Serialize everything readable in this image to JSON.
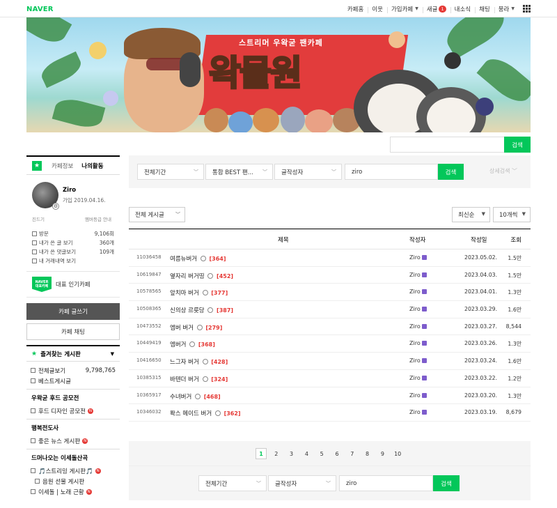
{
  "topbar": {
    "logo": "NAVER",
    "items": [
      {
        "label": "카페홈"
      },
      {
        "label": "이웃"
      },
      {
        "label": "가입카페"
      },
      {
        "label": "새글",
        "badge": "1"
      },
      {
        "label": "내소식"
      },
      {
        "label": "채팅"
      },
      {
        "label": "뭉라"
      }
    ],
    "apps_icon": "grid-icon"
  },
  "banner": {
    "subtitle": "스트리머 우왁굳 팬카페",
    "title": "왁물원"
  },
  "top_search": {
    "value": "",
    "button": "검색"
  },
  "sidebar": {
    "tabs": [
      "카페정보",
      "나의활동"
    ],
    "profile": {
      "name": "Ziro",
      "joined": "가입 2019.04.16.",
      "level_link": "진드기",
      "benefit_link": "멤버등급 안내"
    },
    "stats": [
      {
        "label": "방문",
        "value": "9,106회"
      },
      {
        "label": "내가 쓴 글 보기",
        "value": "360개"
      },
      {
        "label": "내가 쓴 댓글보기",
        "value": "109개"
      },
      {
        "label": "내 거래내역 보기",
        "value": ""
      }
    ],
    "popular_badge_top": "NAVER",
    "popular_badge_bottom": "대표카페",
    "popular_label": "대표 인기카페",
    "write_button": "카페 글쓰기",
    "chat_button": "카페 채팅",
    "favorites_title": "즐겨찾는 게시판",
    "favorites": [
      {
        "label": "전체글보기",
        "count": "9,798,765"
      },
      {
        "label": "베스트게시글",
        "count": ""
      }
    ],
    "groups": [
      {
        "title": "우왁굳 후드 공모전",
        "items": [
          {
            "label": "후드 디자인 공모전",
            "new": "N"
          }
        ]
      },
      {
        "title": "행복전도사",
        "items": [
          {
            "label": "좋은 뉴스 게시판",
            "new": "N"
          }
        ]
      },
      {
        "title": "드머나오는 이세돌산곡",
        "items": [
          {
            "label": "🎵스트리밍 게시판🎵",
            "new": "N"
          },
          {
            "label": "음원 선물 게시판",
            "new": ""
          },
          {
            "label": "이세돌 | 노래 근황",
            "new": "N"
          }
        ]
      }
    ]
  },
  "filters": {
    "period": "전체기간",
    "board": "통합 BEST 팬...",
    "type": "글작성자",
    "query": "ziro",
    "search_button": "검색",
    "advanced": "상세검색"
  },
  "list_controls": {
    "board_select": "전체 게시글",
    "sort": "최신순",
    "per_page": "10개씩"
  },
  "table": {
    "headers": {
      "title": "제목",
      "author": "작성자",
      "date": "작성일",
      "views": "조회"
    },
    "rows": [
      {
        "num": "11036458",
        "title": "여름뉴버거",
        "comments": "[364]",
        "author": "Ziro",
        "date": "2023.05.02.",
        "views": "1.5만"
      },
      {
        "num": "10619847",
        "title": "옆자리 버거띵",
        "comments": "[452]",
        "author": "Ziro",
        "date": "2023.04.03.",
        "views": "1.5만"
      },
      {
        "num": "10578565",
        "title": "앞치마 버거",
        "comments": "[377]",
        "author": "Ziro",
        "date": "2023.04.01.",
        "views": "1.3만"
      },
      {
        "num": "10508365",
        "title": "신의상 르릇당",
        "comments": "[387]",
        "author": "Ziro",
        "date": "2023.03.29.",
        "views": "1.6만"
      },
      {
        "num": "10473552",
        "title": "엠버 버거",
        "comments": "[279]",
        "author": "Ziro",
        "date": "2023.03.27.",
        "views": "8,544"
      },
      {
        "num": "10449419",
        "title": "엠버거",
        "comments": "[368]",
        "author": "Ziro",
        "date": "2023.03.26.",
        "views": "1.3만"
      },
      {
        "num": "10416650",
        "title": "느그자 버거",
        "comments": "[428]",
        "author": "Ziro",
        "date": "2023.03.24.",
        "views": "1.6만"
      },
      {
        "num": "10385315",
        "title": "바텐더 버거",
        "comments": "[324]",
        "author": "Ziro",
        "date": "2023.03.22.",
        "views": "1.2만"
      },
      {
        "num": "10365917",
        "title": "수녀버거",
        "comments": "[468]",
        "author": "Ziro",
        "date": "2023.03.20.",
        "views": "1.3만"
      },
      {
        "num": "10346032",
        "title": "퐉스 메이드 버거",
        "comments": "[362]",
        "author": "Ziro",
        "date": "2023.03.19.",
        "views": "8,679"
      }
    ]
  },
  "pagination": {
    "pages": [
      "1",
      "2",
      "3",
      "4",
      "5",
      "6",
      "7",
      "8",
      "9",
      "10"
    ],
    "current": "1"
  },
  "bottom_search": {
    "period": "전체기간",
    "type": "글작성자",
    "query": "ziro",
    "button": "검색"
  },
  "colors": {
    "brand": "#03c75a",
    "new_badge": "#e53935",
    "comment_count": "#e53935"
  }
}
